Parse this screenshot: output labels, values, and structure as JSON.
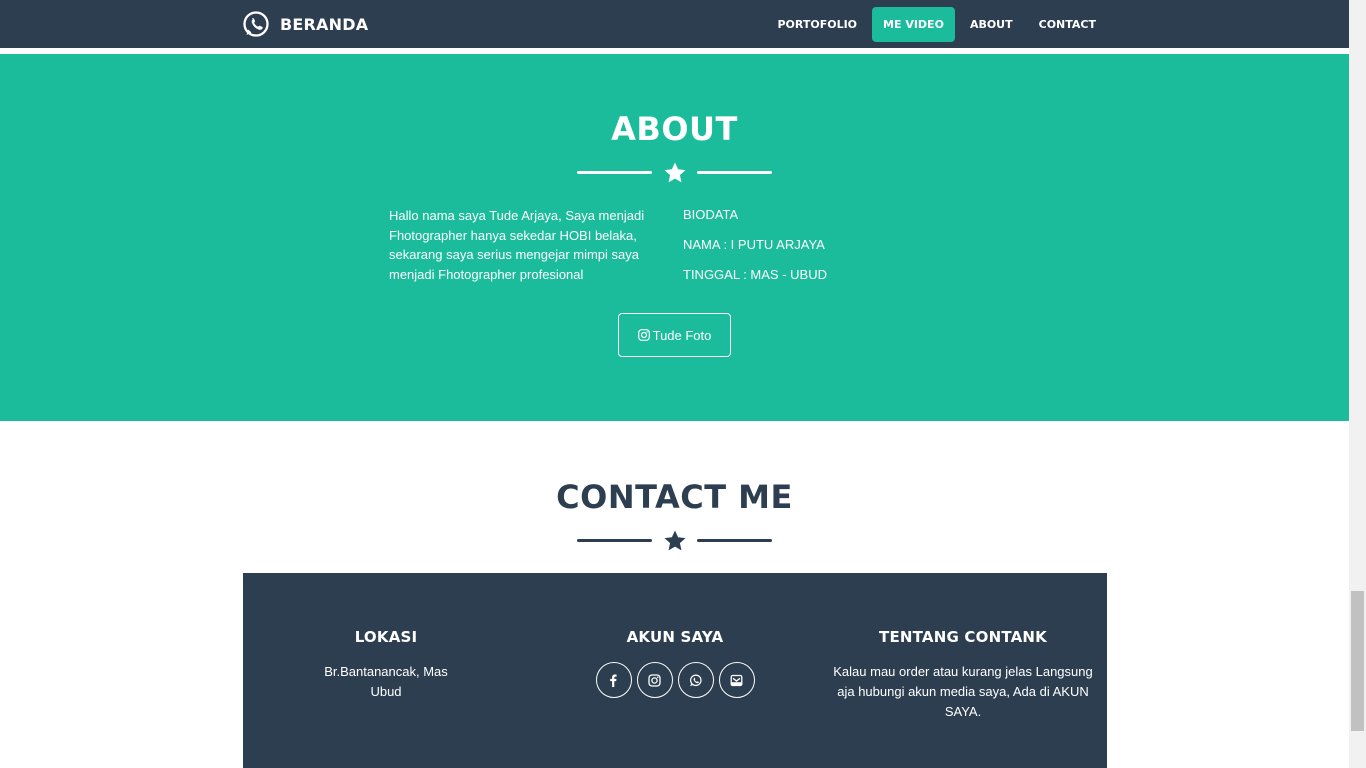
{
  "navbar": {
    "brand": "BERANDA",
    "brand_icon": "whatsapp-icon",
    "links": [
      {
        "label": "PORTOFOLIO",
        "active": false
      },
      {
        "label": "ME VIDEO",
        "active": true
      },
      {
        "label": "ABOUT",
        "active": false
      },
      {
        "label": "CONTACT",
        "active": false
      }
    ]
  },
  "about": {
    "title": "ABOUT",
    "text": "Hallo nama saya Tude Arjaya, Saya menjadi Fhotographer hanya sekedar HOBI belaka, sekarang saya serius mengejar mimpi saya menjadi Fhotographer profesional",
    "bio": [
      "BIODATA",
      "NAMA : I PUTU ARJAYA",
      "TINGGAL : MAS - UBUD"
    ],
    "button": "Tude Foto",
    "button_icon": "instagram-icon"
  },
  "contact": {
    "title": "CONTACT ME"
  },
  "footer": {
    "lokasi": {
      "title": "LOKASI",
      "text": "Br.Bantanancak, Mas Ubud"
    },
    "akun": {
      "title": "AKUN SAYA",
      "icons": [
        "facebook-icon",
        "instagram-icon",
        "whatsapp-icon",
        "email-icon"
      ]
    },
    "tentang": {
      "title": "TENTANG CONTANK",
      "text": "Kalau mau order atau kurang jelas Langsung aja hubungi akun media saya, Ada di AKUN SAYA."
    }
  },
  "colors": {
    "primary": "#2c3e50",
    "accent": "#1abc9c",
    "white": "#ffffff"
  }
}
